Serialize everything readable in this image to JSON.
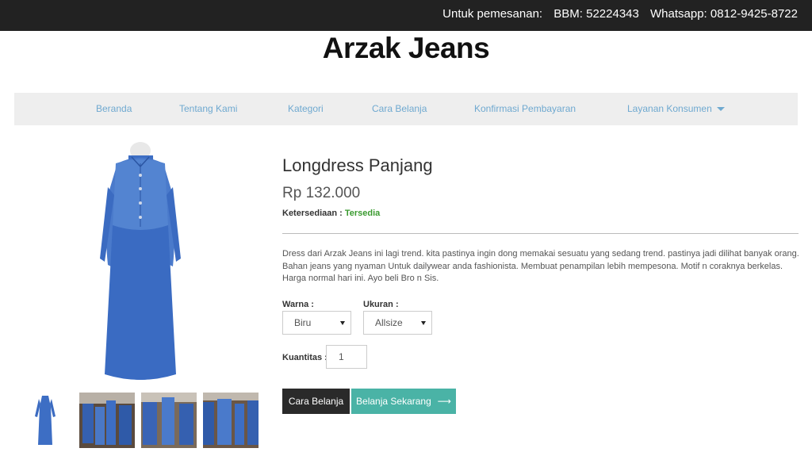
{
  "topbar": {
    "label": "Untuk pemesanan:",
    "bbm": "BBM: 52224343",
    "whatsapp": "Whatsapp: 0812-9425-8722"
  },
  "brand": {
    "title": "Arzak Jeans"
  },
  "nav": {
    "items": [
      "Beranda",
      "Tentang Kami",
      "Kategori",
      "Cara Belanja",
      "Konfirmasi Pembayaran",
      "Layanan Konsumen"
    ]
  },
  "product": {
    "title": "Longdress Panjang",
    "price": "Rp 132.000",
    "stock_label": "Ketersediaan :",
    "stock_value": "Tersedia",
    "description": "Dress dari Arzak Jeans ini lagi trend. kita pastinya ingin dong memakai sesuatu yang sedang trend. pastinya jadi dilihat banyak orang. Bahan jeans yang nyaman Untuk dailywear anda fashionista. Membuat penampilan lebih mempesona. Motif n coraknya berkelas. Harga normal hari ini. Ayo beli Bro n Sis.",
    "color_label": "Warna :",
    "color_value": "Biru",
    "size_label": "Ukuran :",
    "size_value": "Allsize",
    "qty_label": "Kuantitas :",
    "qty_value": "1"
  },
  "buttons": {
    "guide": "Cara Belanja",
    "buy": "Belanja Sekarang",
    "buy_arrow": "⟶"
  },
  "colors": {
    "topbar_bg": "#222222",
    "nav_link": "#6fa9d0",
    "stock_ok": "#3a9a2f",
    "buy_button": "#4ab3a6",
    "guide_button": "#2a2a2a",
    "denim": "#3d6ec4"
  }
}
